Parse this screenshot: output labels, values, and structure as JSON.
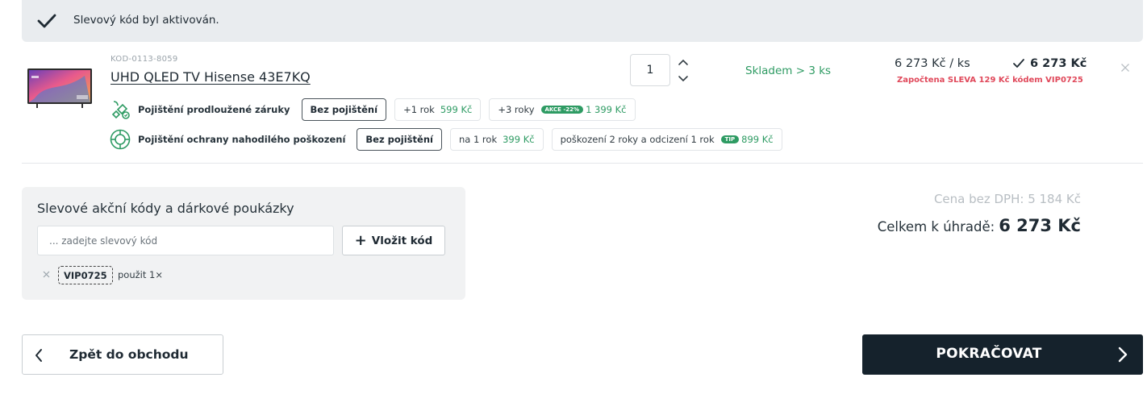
{
  "alert": {
    "message": "Slevový kód byl aktivován.",
    "icon": "check-icon"
  },
  "product": {
    "code": "KOD-0113-8059",
    "name": "UHD QLED TV Hisense 43E7KQ",
    "quantity": "1",
    "stock": "Skladem > 3 ks",
    "unit_price": "6 273 Kč / ks",
    "total_price": "6 273 Kč",
    "discount_note": "Započtena SLEVA 129 Kč kódem VIP0725",
    "insurance_warranty": {
      "label": "Pojištění prodloužené záruky",
      "options": [
        {
          "label": "Bez pojištění",
          "price": "",
          "badge": "",
          "selected": true
        },
        {
          "label": "+1 rok",
          "price": "599 Kč",
          "badge": "",
          "selected": false
        },
        {
          "label": "+3 roky",
          "price": "1 399 Kč",
          "badge": "AKCE -22%",
          "selected": false
        }
      ]
    },
    "insurance_damage": {
      "label": "Pojištění ochrany nahodilého poškození",
      "options": [
        {
          "label": "Bez pojištění",
          "price": "",
          "badge": "",
          "selected": true
        },
        {
          "label": "na 1 rok",
          "price": "399 Kč",
          "badge": "",
          "selected": false
        },
        {
          "label": "poškození 2 roky a odcizení 1 rok",
          "price": "899 Kč",
          "badge": "TIP",
          "selected": false
        }
      ]
    }
  },
  "voucher": {
    "title": "Slevové akční kódy a dárkové poukázky",
    "placeholder": "... zadejte slevový kód",
    "add_label": "Vložit kód",
    "applied_code": "VIP0725",
    "applied_note": "použit 1×"
  },
  "summary": {
    "net_price": "Cena bez DPH: 5 184 Kč",
    "total_label": "Celkem k úhradě:",
    "total_value": "6 273 Kč"
  },
  "nav": {
    "back_label": "Zpět do obchodu",
    "next_label": "POKRAČOVAT"
  },
  "colors": {
    "accent_green": "#2e9b63",
    "discount_red": "#e0485a",
    "dark_button": "#15222c"
  }
}
